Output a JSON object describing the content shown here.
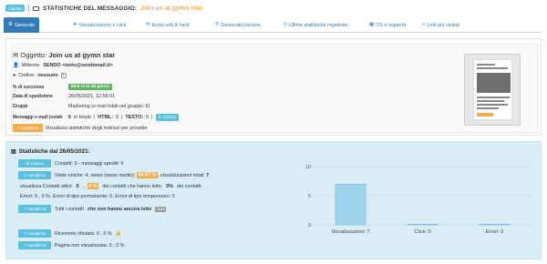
{
  "header": {
    "back_label": "Indietro",
    "title": "STATISTICHE DEL MESSAGGIO:",
    "subject": "Join us at gymn star"
  },
  "tabs": [
    {
      "label": "Generale",
      "icon": "gear-icon"
    },
    {
      "label": "Visualizzazioni e click",
      "icon": "cursor-icon"
    },
    {
      "label": "Errori soft & hard",
      "icon": "envelope-icon"
    },
    {
      "label": "Geolocalizzazione",
      "icon": "map-marker-icon"
    },
    {
      "label": "Ultime statistiche registrate",
      "icon": "clock-icon"
    },
    {
      "label": "OS e supporti",
      "icon": "windows-icon"
    },
    {
      "label": "Link più visitati",
      "icon": "link-icon"
    }
  ],
  "message": {
    "subject_label": "Oggetto:",
    "subject": "Join us at gymn star",
    "sender_label": "Mittente:",
    "sender": "SENDO <invio@sendomail.it>",
    "code_label": "Codice:",
    "code": "nessuno",
    "success_label": "% di successo",
    "success_badge": "66.6 % in 39 giorni",
    "date_label": "Data di spedizione",
    "date": "26/05/2021, 12:58:01",
    "groups_label": "Gruppi",
    "groups": "Marketing (e-mail totali nel gruppo: 6)",
    "sent_label": "Messaggi e-mail inviati",
    "sent_total": "6",
    "sent_total_suffix": "in totale",
    "html_label": "HTML:",
    "html_count": "6",
    "testo_label": "TESTO:",
    "testo_count": "0",
    "scarica_label": "scarica",
    "visualizza_label": "visualizza",
    "providers_text": "Visualizza statistiche degli indirizzi per provider"
  },
  "stats": {
    "title": "Statistiche dal 26/05/2021:",
    "scarica_label": "scarica",
    "visualizza_label": "visualizza",
    "contacts_text": "Contatti: 6 - messaggi spediti: 6",
    "visits_text_a": "Visite uniche: 4, views (tasso medio):",
    "visits_rate": "66.67 %",
    "visits_text_b": ", visualizzazioni totali:",
    "visits_total": "7",
    "active_text_a": "visualizza Contatti attivi:",
    "active_count": "0",
    "active_rate": "0 %",
    "active_text_b": "dei contatti che hanno letto.",
    "active_rate_b": "0%",
    "active_text_c": "dei contatti.",
    "errors_text": "Errori: 0 , 0 %. Errori di tipo permanente: 0, Errori di tipo temporaneo: 0",
    "all_contacts_a": "Tutti i contatti",
    "all_contacts_b": "che non hanno ancora letto",
    "all_contacts_badge": "beta",
    "refused_text": "Ricezione rifiutata: 0 , 0 %",
    "not_viewed_text": "Pagina non visualizzata: 0 , 0 %"
  },
  "chart_data": {
    "type": "bar",
    "categories": [
      "Visualizzazioni: 7",
      "Click: 0",
      "Errori: 0"
    ],
    "values": [
      7,
      0,
      0
    ],
    "ylim": [
      0,
      10
    ],
    "yticks": [
      0,
      5,
      10
    ],
    "grid": true,
    "colors": {
      "bar": "#9ed3ec",
      "bar_stroke": "#62b5dc"
    }
  }
}
